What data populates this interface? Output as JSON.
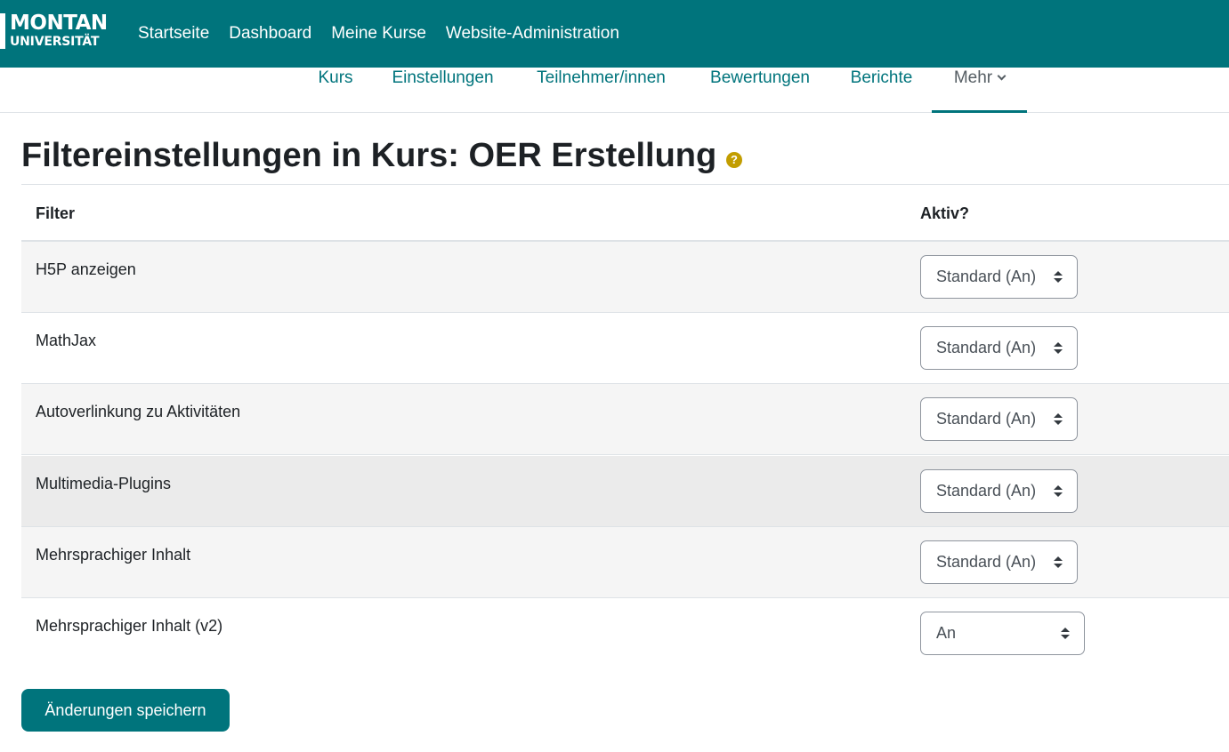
{
  "logo": {
    "line1": "MONTAN",
    "line2": "UNIVERSITÄT"
  },
  "topnav": [
    "Startseite",
    "Dashboard",
    "Meine Kurse",
    "Website-Administration"
  ],
  "secnav": {
    "items": [
      "Kurs",
      "Einstellungen",
      "Teilnehmer/innen",
      "Bewertungen",
      "Berichte"
    ],
    "more": "Mehr"
  },
  "page": {
    "title": "Filtereinstellungen in Kurs: OER Erstellung",
    "help_icon": "question-circle-icon"
  },
  "table": {
    "headers": {
      "filter": "Filter",
      "active": "Aktiv?"
    },
    "rows": [
      {
        "name": "H5P anzeigen",
        "value": "Standard (An)"
      },
      {
        "name": "MathJax",
        "value": "Standard (An)"
      },
      {
        "name": "Autoverlinkung zu Aktivitäten",
        "value": "Standard (An)"
      },
      {
        "name": "Multimedia-Plugins",
        "value": "Standard (An)"
      },
      {
        "name": "Mehrsprachiger Inhalt",
        "value": "Standard (An)"
      },
      {
        "name": "Mehrsprachiger Inhalt (v2)",
        "value": "An"
      }
    ]
  },
  "save_button": "Änderungen speichern",
  "colors": {
    "brand": "#00747c",
    "help": "#c29d00",
    "row_stripe": "#f5f5f5",
    "row_hover": "#ebebeb"
  }
}
